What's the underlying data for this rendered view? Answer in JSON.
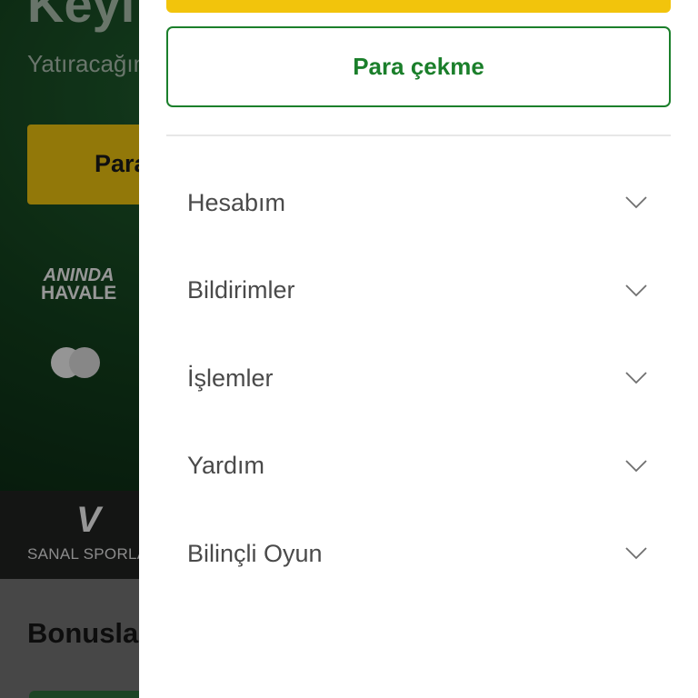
{
  "background": {
    "hero_title": "Keyif",
    "hero_subtitle": "Yatıracağınız",
    "deposit_button": "Para yatır",
    "payment": {
      "havale_line1": "ANINDA",
      "havale_line2": "HAVALE",
      "card_icon": "mastercard-icon"
    },
    "virtual_sports": {
      "logo": "V",
      "label": "SANAL SPORLAR"
    },
    "bonus_title": "Bonuslar"
  },
  "drawer": {
    "withdraw_label": "Para çekme",
    "menu_items": [
      {
        "label": "Hesabım",
        "icon": "chevron-down-icon"
      },
      {
        "label": "Bildirimler",
        "icon": "chevron-down-icon"
      },
      {
        "label": "İşlemler",
        "icon": "chevron-down-icon"
      },
      {
        "label": "Yardım",
        "icon": "chevron-down-icon"
      },
      {
        "label": "Bilinçli Oyun",
        "icon": "chevron-down-icon"
      }
    ]
  },
  "colors": {
    "brand_green": "#1b7f2b",
    "brand_yellow": "#f2c40c"
  }
}
